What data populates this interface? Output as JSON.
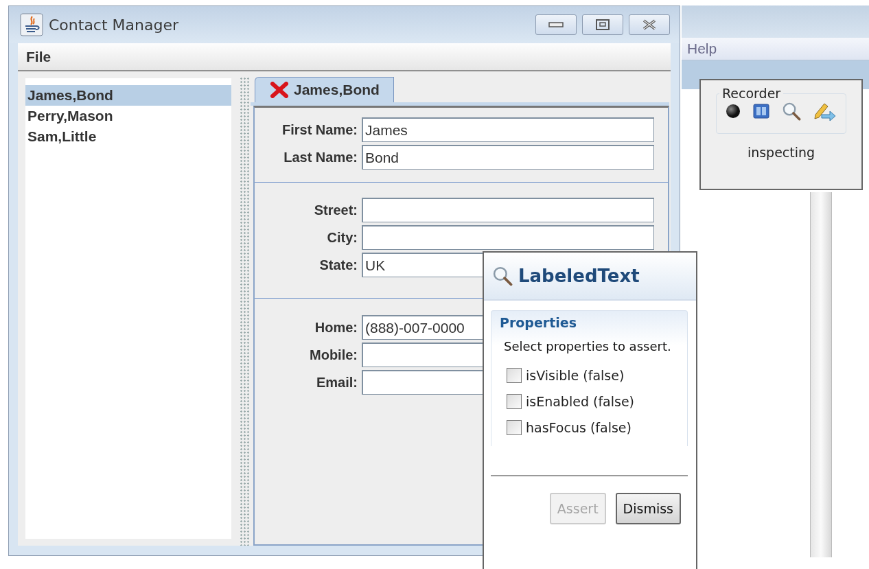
{
  "window": {
    "title": "Contact Manager"
  },
  "menu": [
    {
      "label": "File"
    }
  ],
  "contacts": [
    {
      "name": "James,Bond",
      "selected": true
    },
    {
      "name": "Perry,Mason",
      "selected": false
    },
    {
      "name": "Sam,Little",
      "selected": false
    }
  ],
  "tabs": [
    {
      "label": "James,Bond",
      "selected": true
    }
  ],
  "form_sections": [
    {
      "fields": [
        {
          "label": "First Name:",
          "value": "James"
        },
        {
          "label": "Last Name:",
          "value": "Bond"
        }
      ]
    },
    {
      "fields": [
        {
          "label": "Street:"
        },
        {
          "label": "City:"
        },
        {
          "label": "State:",
          "value": "UK"
        }
      ]
    },
    {
      "fields": [
        {
          "label": "Home:",
          "value": "(888)-007-0000"
        },
        {
          "label": "Mobile:"
        },
        {
          "label": "Email:"
        }
      ]
    }
  ],
  "background_window": {
    "menu": [
      {
        "label": "Help"
      }
    ]
  },
  "recorder": {
    "title": "Recorder",
    "status": "inspecting"
  },
  "inspector": {
    "title": "LabeledText",
    "section": "Properties",
    "instruction": "Select properties to assert.",
    "properties": [
      {
        "label": "isVisible (false)",
        "checked": false
      },
      {
        "label": "isEnabled (false)",
        "checked": false
      },
      {
        "label": "hasFocus (false)",
        "checked": false
      }
    ],
    "buttons": [
      {
        "label": "Assert",
        "disabled": true
      },
      {
        "label": "Dismiss",
        "disabled": false
      }
    ]
  }
}
